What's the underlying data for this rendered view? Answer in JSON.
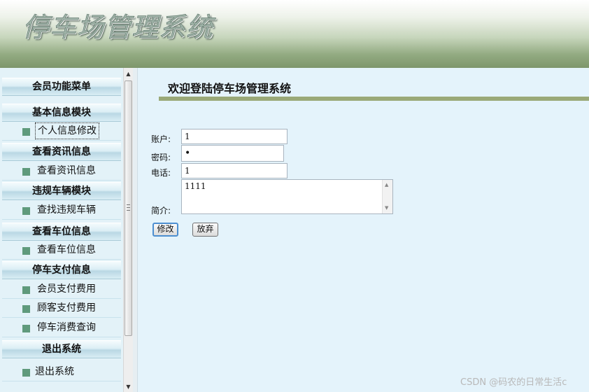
{
  "header": {
    "title": "停车场管理系统"
  },
  "sidebar": {
    "menu_title": "会员功能菜单",
    "groups": [
      {
        "title": "基本信息模块",
        "items": [
          "个人信息修改"
        ]
      },
      {
        "title": "查看资讯信息",
        "items": [
          "查看资讯信息"
        ]
      },
      {
        "title": "违规车辆模块",
        "items": [
          "查找违规车辆"
        ]
      },
      {
        "title": "查看车位信息",
        "items": [
          "查看车位信息"
        ]
      },
      {
        "title": "停车支付信息",
        "items": [
          "会员支付费用",
          "顾客支付费用",
          "停车消费查询"
        ]
      },
      {
        "title": "退出系统",
        "items": [
          "退出系统"
        ]
      }
    ],
    "focused_item": "个人信息修改"
  },
  "main": {
    "welcome": "欢迎登陆停车场管理系统",
    "form": {
      "account_label": "账户:",
      "account_value": "1",
      "password_label": "密码:",
      "password_value": "•",
      "phone_label": "电话:",
      "phone_value": "1",
      "intro_label": "简介:",
      "intro_value": "1111",
      "submit_label": "修改",
      "cancel_label": "放弃"
    }
  },
  "watermark": "CSDN @码农的日常生活c",
  "colors": {
    "sidebar_bg": "#e3f2f8",
    "main_bg": "#e4f3fb",
    "bullet": "#5f9a7c",
    "welcome_bar": "#9aa978",
    "primary_button_border": "#4d8fd0"
  }
}
